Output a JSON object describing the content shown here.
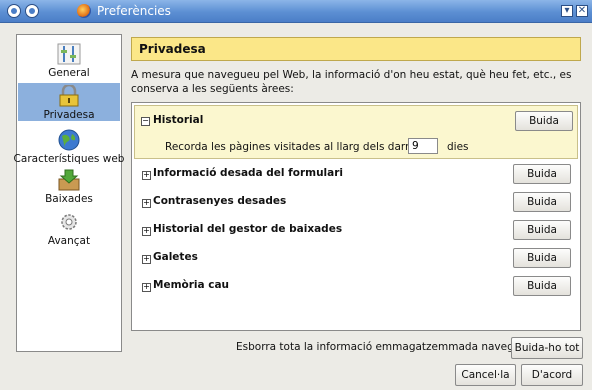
{
  "window": {
    "title": "Preferències"
  },
  "sidebar": {
    "items": [
      {
        "label": "General",
        "icon": "general-sliders-icon",
        "selected": false
      },
      {
        "label": "Privadesa",
        "icon": "padlock-icon",
        "selected": true
      },
      {
        "label": "Característiques web",
        "icon": "globe-icon",
        "selected": false
      },
      {
        "label": "Baixades",
        "icon": "download-box-icon",
        "selected": false
      },
      {
        "label": "Avançat",
        "icon": "gear-icon",
        "selected": false
      }
    ]
  },
  "main": {
    "header": "Privadesa",
    "description": "A mesura que navegueu pel Web, la informació d'on heu estat, què heu fet, etc., es conserva a les següents àrees:",
    "sections": [
      {
        "label": "Historial",
        "button": "Buida",
        "expanded": true,
        "detail": {
          "text": "Recorda les pàgines visitades al llarg dels darrers",
          "value": "9",
          "unit": "dies"
        }
      },
      {
        "label": "Informació desada del formulari",
        "button": "Buida",
        "expanded": false
      },
      {
        "label": "Contrasenyes desades",
        "button": "Buida",
        "expanded": false
      },
      {
        "label": "Historial del gestor de baixades",
        "button": "Buida",
        "expanded": false
      },
      {
        "label": "Galetes",
        "button": "Buida",
        "expanded": false
      },
      {
        "label": "Memòria cau",
        "button": "Buida",
        "expanded": false
      }
    ],
    "clear_all_text": "Esborra tota la informació emmagatzemmada navegant:",
    "clear_all_button": "Buida-ho tot"
  },
  "footer": {
    "cancel": "Cancel·la",
    "ok": "D'acord"
  },
  "colors": {
    "titlebar": "#5c8fd3",
    "header_bg": "#fbe788",
    "selected_bg": "#8cb0dd",
    "expanded_bg": "#fbf7cf"
  }
}
